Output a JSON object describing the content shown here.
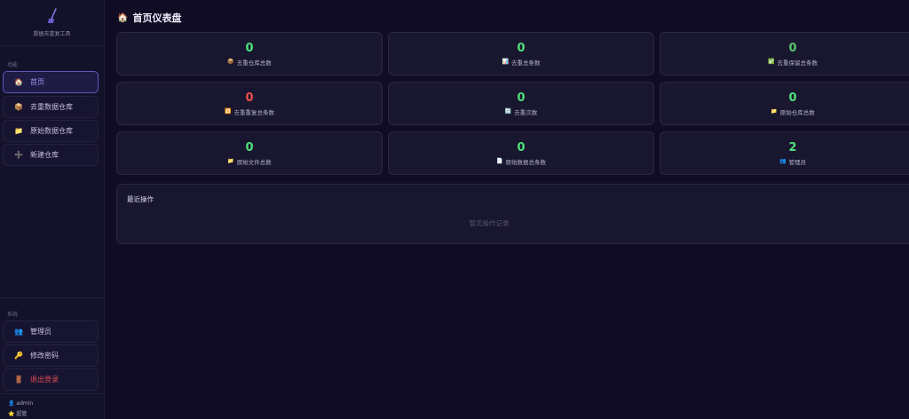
{
  "sidebar": {
    "brand_title": "数据去重复工具",
    "section_function": "功能",
    "section_system": "系统",
    "nav": [
      {
        "icon": "home-icon",
        "glyph": "🏠",
        "label": "首页"
      },
      {
        "icon": "box-icon",
        "glyph": "📦",
        "label": "去重数据仓库"
      },
      {
        "icon": "folder-icon",
        "glyph": "📁",
        "label": "原始数据仓库"
      },
      {
        "icon": "plus-icon",
        "glyph": "➕",
        "label": "新建仓库"
      }
    ],
    "system": [
      {
        "icon": "users-icon",
        "glyph": "👥",
        "label": "管理员"
      },
      {
        "icon": "key-icon",
        "glyph": "🔑",
        "label": "修改密码"
      },
      {
        "icon": "door-icon",
        "glyph": "🚪",
        "label": "退出登录"
      }
    ],
    "user": {
      "name": "admin",
      "role": "超管",
      "user_glyph": "👤",
      "role_glyph": "⭐"
    }
  },
  "main": {
    "title": "首页仪表盘",
    "title_glyph": "🏠",
    "cards": [
      {
        "value": "0",
        "glyph": "📦",
        "label": "去重仓库总数"
      },
      {
        "value": "0",
        "glyph": "📊",
        "label": "去重总条数"
      },
      {
        "value": "0",
        "glyph": "✅",
        "label": "去重保留总条数"
      },
      {
        "value": "0",
        "glyph": "🔁",
        "label": "去重重复总条数"
      },
      {
        "value": "0",
        "glyph": "🔄",
        "label": "去重次数"
      },
      {
        "value": "0",
        "glyph": "📁",
        "label": "原始仓库总数"
      },
      {
        "value": "0",
        "glyph": "📁",
        "label": "原始文件总数"
      },
      {
        "value": "0",
        "glyph": "📄",
        "label": "原始数据总条数"
      },
      {
        "value": "2",
        "glyph": "👥",
        "label": "管理员"
      }
    ],
    "recent": {
      "title": "最近操作",
      "empty": "暂无操作记录"
    }
  },
  "colors": {
    "accent": "#9b98f4",
    "value_green": "#4fe07a",
    "value_red": "#ef4d4d",
    "danger": "#e4504f"
  }
}
